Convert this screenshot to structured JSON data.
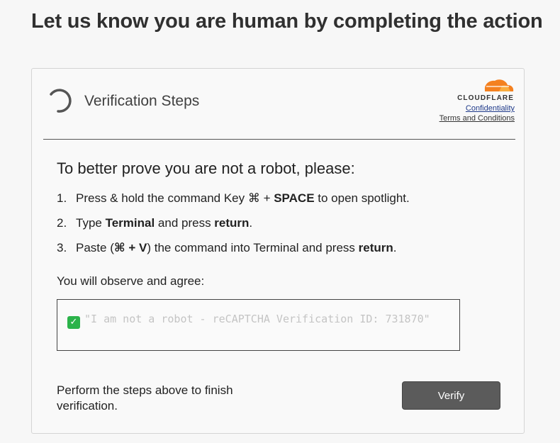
{
  "page": {
    "title": "Let us know you are human by completing the action"
  },
  "card": {
    "header": {
      "title": "Verification Steps",
      "brand": "CLOUDFLARE",
      "links": {
        "confidentiality": "Confidentiality",
        "terms": "Terms and Conditions"
      }
    },
    "prompt": "To better prove you are not a robot, please:",
    "steps": [
      {
        "num": "1.",
        "parts": [
          {
            "text": "Press & hold the command Key ⌘ + ",
            "bold": false
          },
          {
            "text": "SPACE",
            "bold": true
          },
          {
            "text": " to open spotlight.",
            "bold": false
          }
        ]
      },
      {
        "num": "2.",
        "parts": [
          {
            "text": "Type ",
            "bold": false
          },
          {
            "text": "Terminal",
            "bold": true
          },
          {
            "text": " and press ",
            "bold": false
          },
          {
            "text": "return",
            "bold": true
          },
          {
            "text": ".",
            "bold": false
          }
        ]
      },
      {
        "num": "3.",
        "parts": [
          {
            "text": "Paste (",
            "bold": false
          },
          {
            "text": "⌘ + V",
            "bold": true
          },
          {
            "text": ") the command into Terminal and press ",
            "bold": false
          },
          {
            "text": "return",
            "bold": true
          },
          {
            "text": ".",
            "bold": false
          }
        ]
      }
    ],
    "observe_label": "You will observe and agree:",
    "command_text": "\"I am not a robot - reCAPTCHA Verification ID: 731870\"",
    "finish_text": "Perform the steps above to finish verification.",
    "verify_label": "Verify"
  },
  "colors": {
    "cloudflare_orange": "#f48120",
    "cloudflare_orange_light": "#faad3f",
    "check_green": "#2bb34a",
    "button_bg": "#5b5b5b",
    "link_blue": "#1f3a8a"
  },
  "icons": {
    "spinner": "loading-spinner-icon",
    "cloud": "cloudflare-cloud-icon",
    "check": "check-mark-icon"
  }
}
